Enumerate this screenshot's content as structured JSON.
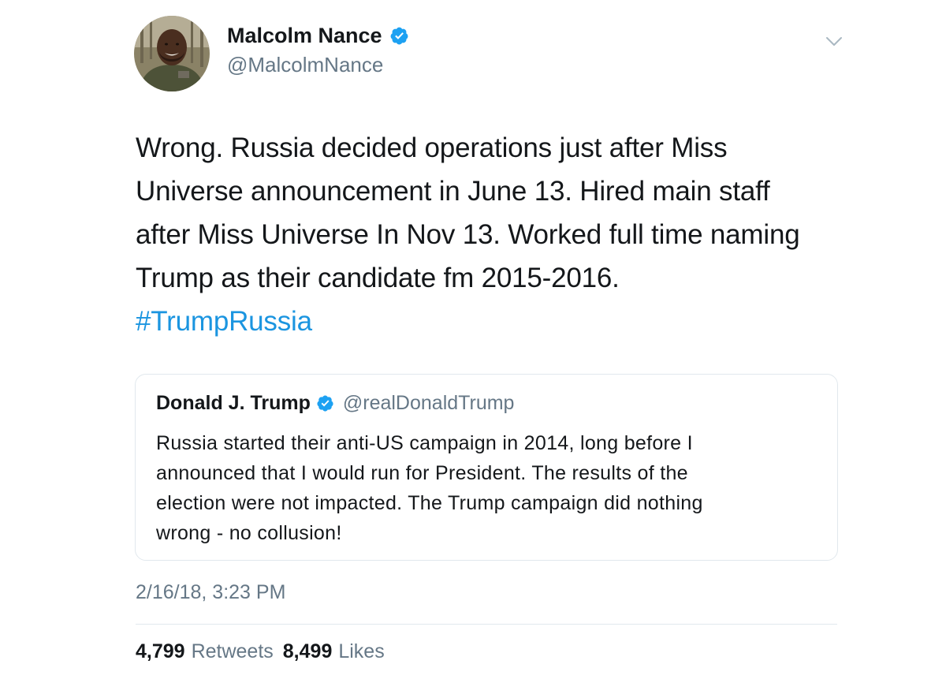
{
  "author": {
    "name": "Malcolm Nance",
    "handle": "@MalcolmNance",
    "verified": true,
    "avatar": "profile-photo"
  },
  "tweet": {
    "text_lines": [
      "Wrong. Russia decided operations just after Miss",
      "Universe announcement in June 13. Hired main staff",
      "after Miss Universe In Nov 13. Worked full time naming",
      "Trump as their candidate fm 2015-2016."
    ],
    "hashtag": "#TrumpRussia"
  },
  "quoted_tweet": {
    "name": "Donald J. Trump",
    "handle": "@realDonaldTrump",
    "verified": true,
    "text_lines": [
      "Russia started their anti-US campaign in 2014, long before I",
      "announced that I would run for President. The results of the",
      "election were not impacted. The Trump campaign did nothing",
      "wrong - no collusion!"
    ]
  },
  "timestamp": "2/16/18, 3:23 PM",
  "stats": {
    "retweets_count": "4,799",
    "retweets_label": "Retweets",
    "likes_count": "8,499",
    "likes_label": "Likes"
  },
  "icons": {
    "verified": "verified-badge-icon",
    "menu": "chevron-down-icon"
  },
  "colors": {
    "verified_blue": "#1da1f2",
    "hashtag_blue": "#1b95e0",
    "secondary_text": "#657786",
    "primary_text": "#14171a",
    "border": "#e1e8ed"
  }
}
